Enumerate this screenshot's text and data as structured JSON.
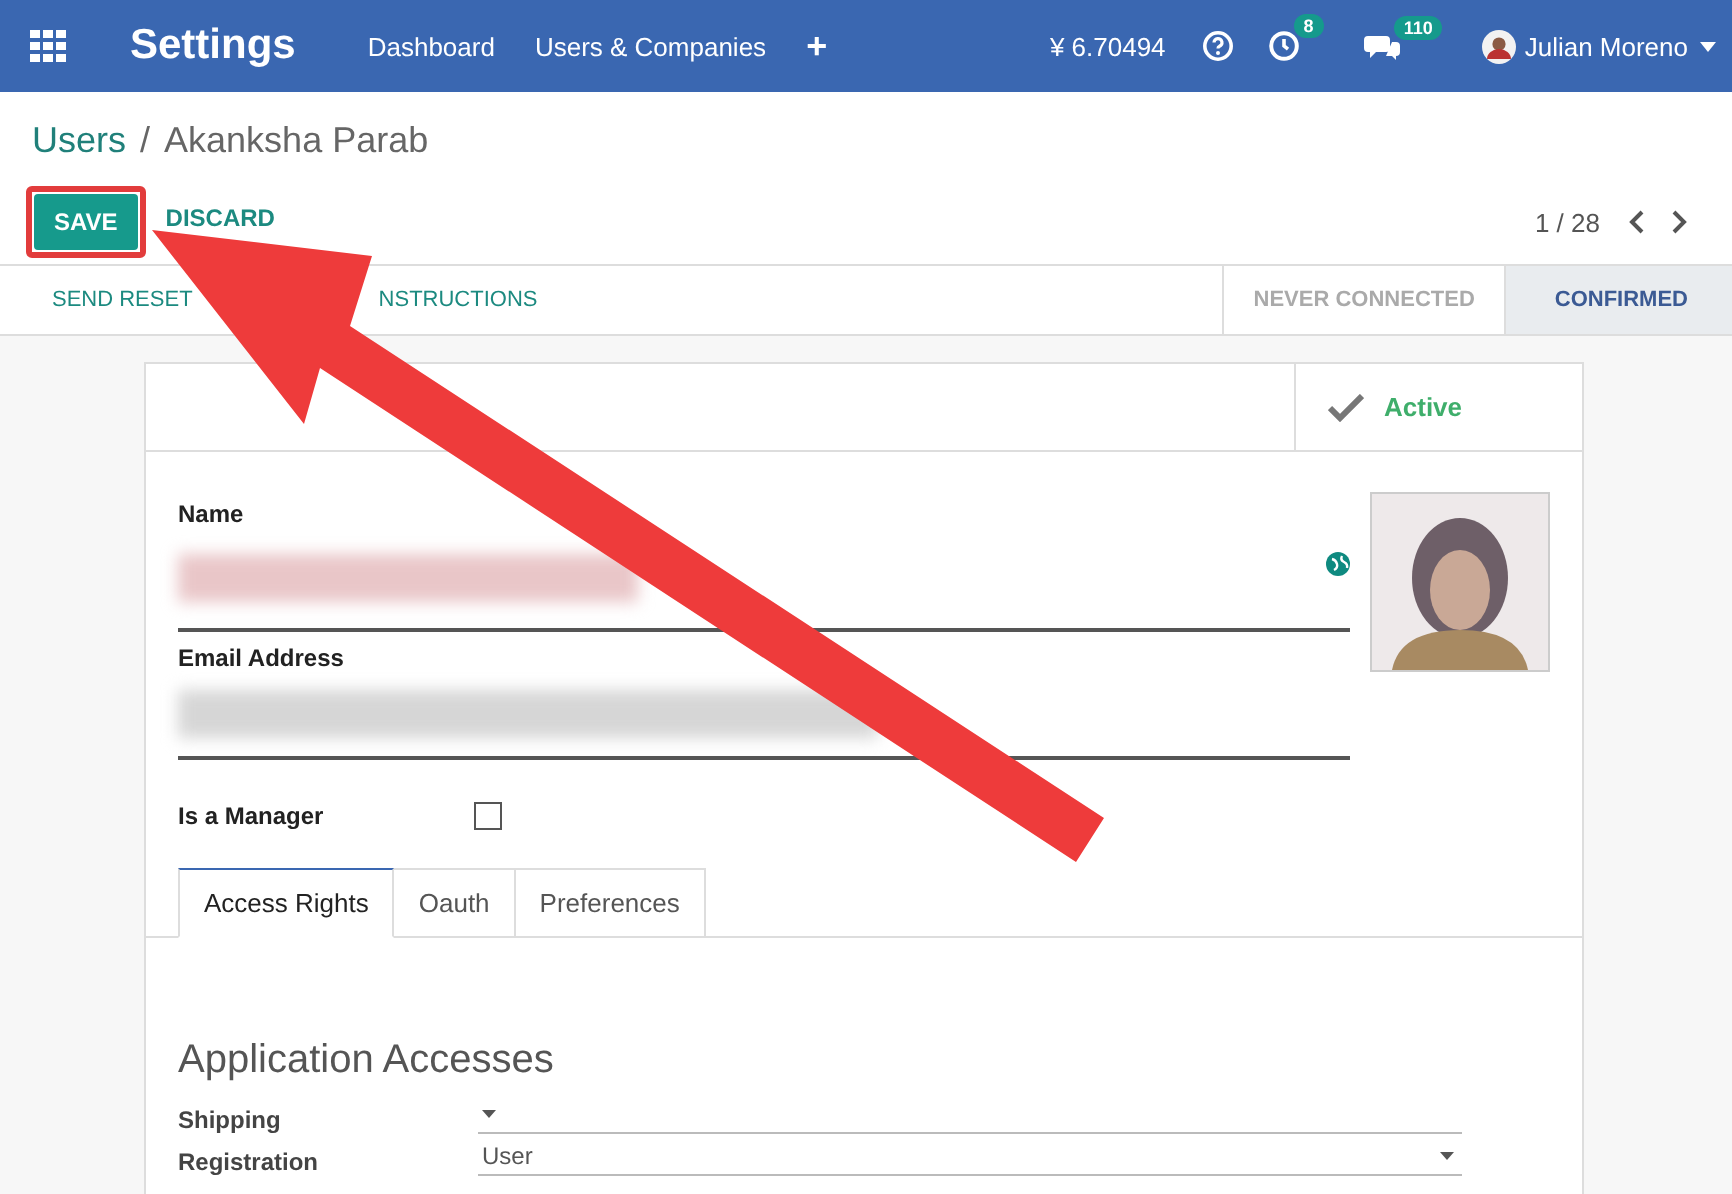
{
  "navbar": {
    "app_title": "Settings",
    "menu": [
      "Dashboard",
      "Users & Companies",
      "+"
    ],
    "balance": "¥ 6.70494",
    "activity_count": "8",
    "message_count": "110",
    "user_name": "Julian Moreno"
  },
  "breadcrumb": {
    "parent": "Users",
    "separator": "/",
    "current": "Akanksha Parab"
  },
  "actions": {
    "save": "SAVE",
    "discard": "DISCARD",
    "pager": "1 / 28"
  },
  "header": {
    "reset_visible_start": "SEND RESET",
    "reset_visible_end": "NSTRUCTIONS",
    "stages": [
      {
        "label": "NEVER CONNECTED",
        "selected": false
      },
      {
        "label": "CONFIRMED",
        "selected": true
      }
    ]
  },
  "sheet": {
    "active_label": "Active",
    "active": true,
    "fields": [
      {
        "label": "Name",
        "kind": "title"
      },
      {
        "label": "Email Address",
        "kind": "text"
      }
    ],
    "manager": {
      "label": "Is a Manager",
      "checked": false
    },
    "tabs": [
      {
        "label": "Access Rights",
        "selected": true
      },
      {
        "label": "Oauth",
        "selected": false
      },
      {
        "label": "Preferences",
        "selected": false
      }
    ],
    "section_title": "Application Accesses",
    "rows": [
      {
        "label": "Shipping",
        "value": ""
      },
      {
        "label": "Registration",
        "value": "User"
      }
    ]
  }
}
